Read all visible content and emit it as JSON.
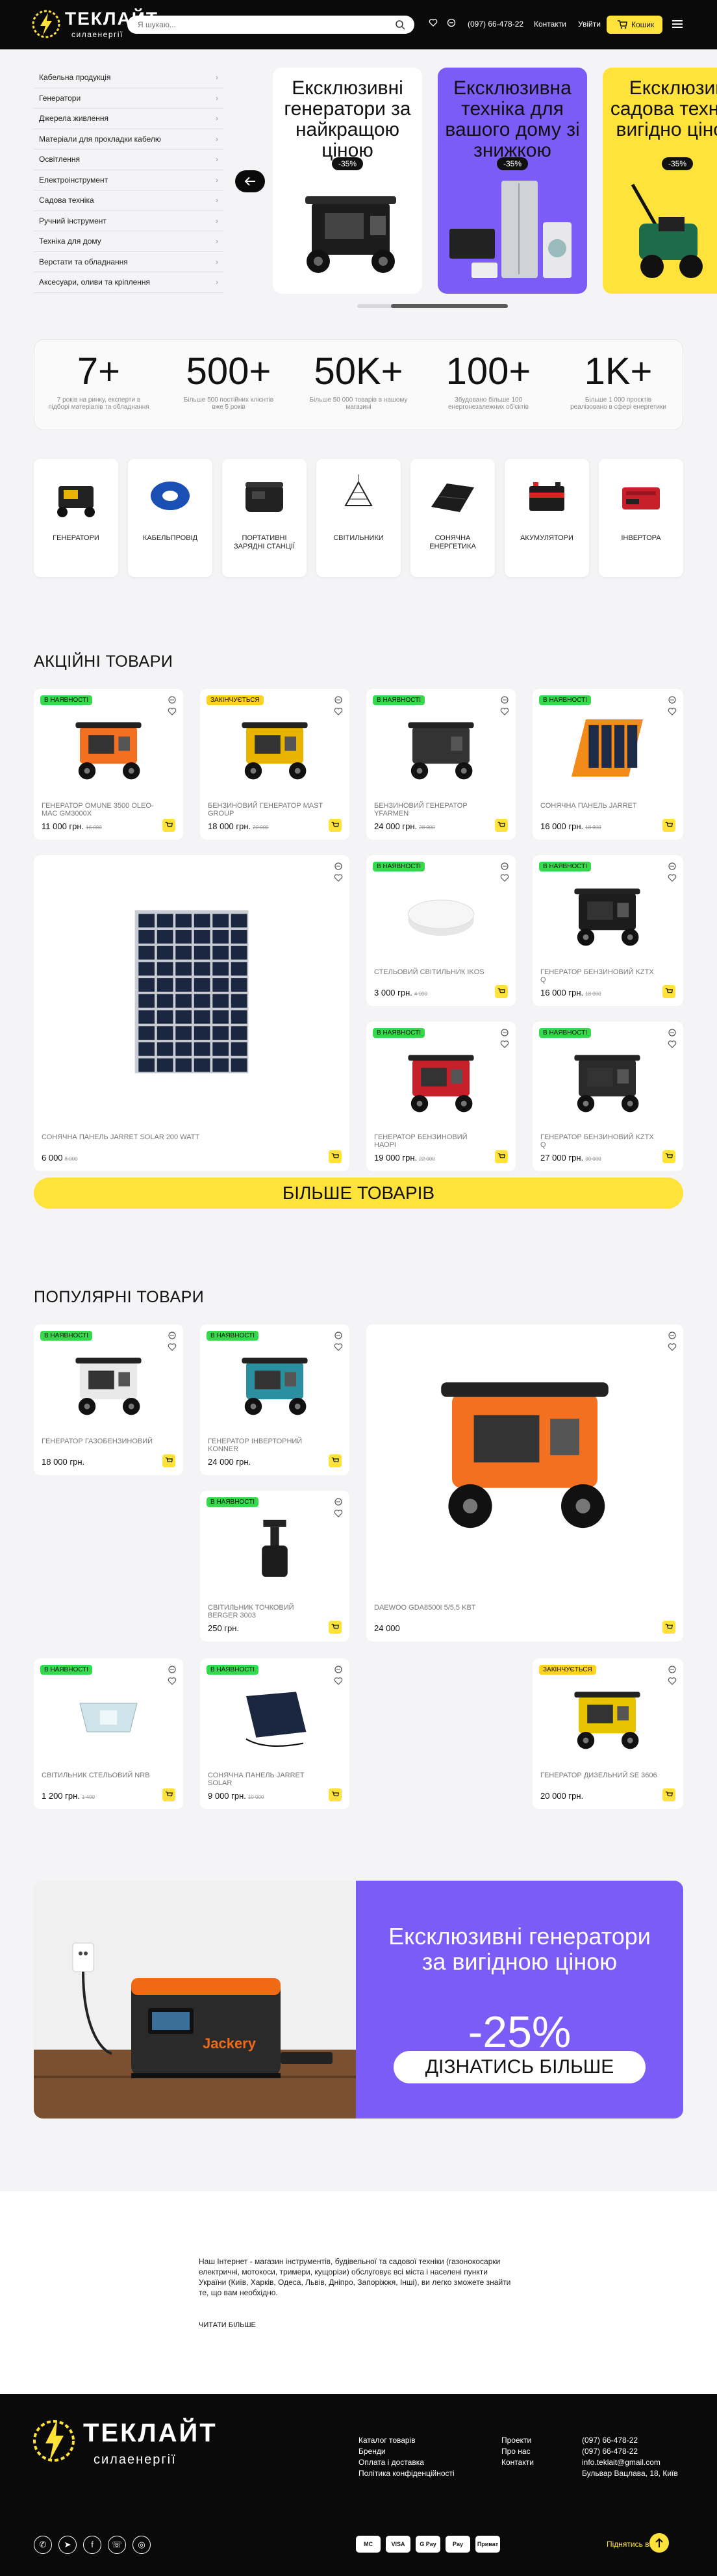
{
  "header": {
    "logo_title": "ТЕКЛАЙТ",
    "logo_subtitle": "силаенергії",
    "search_placeholder": "Я шукаю...",
    "phone": "(097) 66-478-22",
    "contacts": "Контакти",
    "login": "Увійти",
    "cart": "Кошик"
  },
  "catalog": [
    "Кабельна продукція",
    "Генератори",
    "Джерела живлення",
    "Матеріали для прокладки кабелю",
    "Освітлення",
    "Електроінструмент",
    "Садова техніка",
    "Ручний інструмент",
    "Техніка для дому",
    "Верстати та обладнання",
    "Аксесуари, оливи та кріплення"
  ],
  "hero": [
    {
      "title": "Ексклюзивні генератори за найкращою ціною",
      "badge": "-35%",
      "bg": "#ffffff"
    },
    {
      "title": "Ексклюзивна техніка для вашого дому зі знижкою",
      "badge": "-35%",
      "bg": "#7b5cf7"
    },
    {
      "title": "Ексклюзив садова техн за вигідно ціною",
      "badge": "-35%",
      "bg": "#ffe33b"
    }
  ],
  "stats": [
    {
      "n": "7+",
      "d": "7 років на ринку, експерти в підборі матеріалів та обладнання"
    },
    {
      "n": "500+",
      "d": "Більше 500 постійних клієнтів вже 5 років"
    },
    {
      "n": "50K+",
      "d": "Більше 50 000 товарів в нашому магазині"
    },
    {
      "n": "100+",
      "d": "Збудовано більше 100 енергонезалежних об'єктів"
    },
    {
      "n": "1K+",
      "d": "Більше 1 000 проєктів реалізовано в сфері енергетики"
    }
  ],
  "categories": [
    "ГЕНЕРАТОРИ",
    "КАБЕЛЬПРОВІД",
    "ПОРТАТИВНІ ЗАРЯДНІ СТАНЦІЇ",
    "СВІТИЛЬНИКИ",
    "СОНЯЧНА ЕНЕРГЕТИКА",
    "АКУМУЛЯТОРИ",
    "ІНВЕРТОРА"
  ],
  "sections": {
    "sale": "АКЦІЙНІ ТОВАРИ",
    "popular": "ПОПУЛЯРНІ ТОВАРИ",
    "more": "БІЛЬШЕ ТОВАРІВ"
  },
  "sale_products": [
    {
      "badge": "В НАЯВНОСТІ",
      "name": "ГЕНЕРАТОР OMUNE 3500 OLEO-MAC GM3000X",
      "price": "11 000 грн.",
      "old": "16 000"
    },
    {
      "badge": "ЗАКІНЧУЄТЬСЯ",
      "name": "БЕНЗИНОВИЙ ГЕНЕРАТОР MAST GROUP",
      "price": "18 000 грн.",
      "old": "20 000"
    },
    {
      "badge": "В НАЯВНОСТІ",
      "name": "БЕНЗИНОВИЙ ГЕНЕРАТОР YFARMEN",
      "price": "24 000 грн.",
      "old": "28 000"
    },
    {
      "badge": "В НАЯВНОСТІ",
      "name": "СОНЯЧНА ПАНЕЛЬ JARRET",
      "price": "16 000 грн.",
      "old": "18 000"
    },
    {
      "badge": "",
      "name": "СОНЯЧНА ПАНЕЛЬ JARRET SOLAR 200 WATT",
      "price": "6 000",
      "old": "8 000"
    },
    {
      "badge": "В НАЯВНОСТІ",
      "name": "СТЕЛЬОВИЙ СВІТИЛЬНИК IKOS",
      "price": "3 000 грн.",
      "old": "4 000"
    },
    {
      "badge": "В НАЯВНОСТІ",
      "name": "ГЕНЕРАТОР БЕНЗИНОВИЙ KZTX Q",
      "price": "16 000 грн.",
      "old": "18 000"
    },
    {
      "badge": "В НАЯВНОСТІ",
      "name": "ГЕНЕРАТОР БЕНЗИНОВИЙ НАОРІ",
      "price": "19 000 грн.",
      "old": "22 000"
    },
    {
      "badge": "В НАЯВНОСТІ",
      "name": "ГЕНЕРАТОР БЕНЗИНОВИЙ KZTX Q",
      "price": "27 000 грн.",
      "old": "30 000"
    }
  ],
  "popular_products": [
    {
      "badge": "В НАЯВНОСТІ",
      "name": "ГЕНЕРАТОР ГАЗОБЕНЗИНОВИЙ",
      "price": "18 000 грн.",
      "old": ""
    },
    {
      "badge": "В НАЯВНОСТІ",
      "name": "ГЕНЕРАТОР ІНВЕРТОРНИЙ KONNER",
      "price": "24 000 грн.",
      "old": ""
    },
    {
      "badge": "",
      "name": "DAEWOO GDA8500i 5/5,5 KBT",
      "price": "24 000",
      "old": ""
    },
    {
      "badge": "В НАЯВНОСТІ",
      "name": "СВІТИЛЬНИК ТОЧКОВИЙ BERGER 3003",
      "price": "250 грн.",
      "old": ""
    },
    {
      "badge": "В НАЯВНОСТІ",
      "name": "СВІТИЛЬНИК СТЕЛЬОВИЙ NRB",
      "price": "1 200 грн.",
      "old": "1 400"
    },
    {
      "badge": "В НАЯВНОСТІ",
      "name": "СОНЯЧНА ПАНЕЛЬ JARRET SOLAR",
      "price": "9 000 грн.",
      "old": "10 000"
    },
    {
      "badge": "ЗАКІНЧУЄТЬСЯ",
      "name": "ГЕНЕРАТОР ДИЗЕЛЬНИЙ SE 3606",
      "price": "20 000 грн.",
      "old": ""
    }
  ],
  "banner": {
    "title": "Ексклюзивні генератори за вигідною ціною",
    "percent": "-25%",
    "button": "ДІЗНАТИСЬ БІЛЬШЕ"
  },
  "seo": {
    "text": "Наш Інтернет - магазин інструментів, будівельної та садової техніки (газонокосарки електричні, мотокоси, тримери, кущорізи) обслуговує всі міста і населені пункти України (Київ, Харків, Одеса, Львів, Дніпро, Запоріжжя, Інші), ви легко зможете знайти те, що вам необхідно.",
    "read_more": "ЧИТАТИ БІЛЬШЕ"
  },
  "footer": {
    "col1": [
      "Каталог товарів",
      "Бренди",
      "Оплата і доставка",
      "Політика конфіденційності"
    ],
    "col2": [
      "Проекти",
      "Про нас",
      "Контакти"
    ],
    "col3": [
      "(097) 66-478-22",
      "(097) 66-478-22",
      "info.teklait@gmail.com",
      "Бульвар Вацлава, 18, Київ"
    ],
    "up": "Піднятись вверх",
    "payments": [
      "MC",
      "VISA",
      "G Pay",
      "Pay",
      "Приват"
    ]
  }
}
